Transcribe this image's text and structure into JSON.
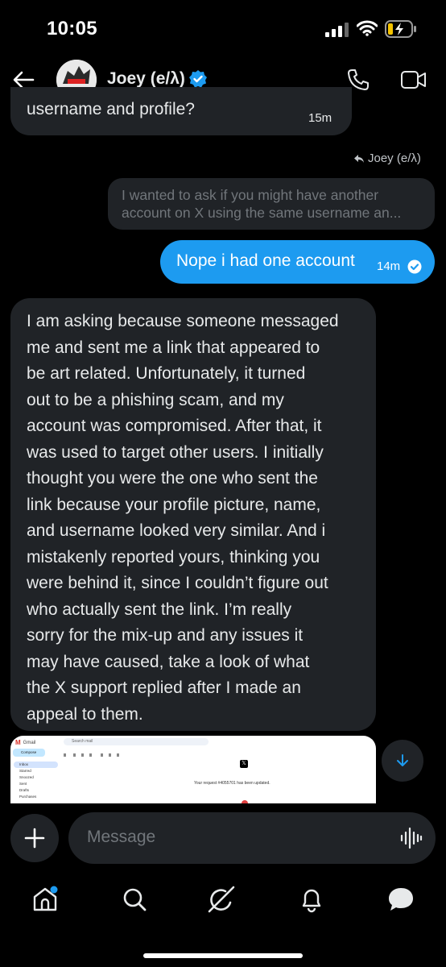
{
  "status_bar": {
    "time": "10:05"
  },
  "header": {
    "name": "Joey (e/λ)"
  },
  "messages": {
    "top": {
      "text": "username and profile?",
      "time": "15m"
    },
    "reply_label": "Joey (e/λ)",
    "quoted": "I wanted to ask if you might have another account on X using the same username an...",
    "outgoing": {
      "text": "Nope i had one account",
      "time": "14m"
    },
    "long_lines": [
      "I am asking because someone messaged",
      "me and sent me a link that appeared to",
      "be art related. Unfortunately, it turned",
      "out to be a phishing scam, and my",
      "account was compromised. After that, it",
      "was used to target other users. I initially",
      "thought you were the one who sent the",
      "link because your profile picture, name,",
      "and username looked very similar. And i",
      "mistakenly reported yours, thinking you",
      "were behind it, since I couldn’t figure out",
      "who actually sent the link. I’m really",
      "sorry for the mix-up and any issues it",
      "may have caused, take a look of what",
      "the X support replied after I made an",
      "appeal to them."
    ]
  },
  "preview": {
    "app": "Gmail",
    "search": "Search mail",
    "compose": "Compose",
    "folders": [
      "Inbox",
      "Starred",
      "Snoozed",
      "Sent",
      "Drafts",
      "Purchases"
    ],
    "notice": "Your request #4055701 has been updated."
  },
  "composer": {
    "placeholder": "Message"
  },
  "icons": {
    "back": "arrow-left-icon",
    "verified": "verified-badge-icon",
    "call": "phone-icon",
    "video": "video-icon",
    "plus": "plus-icon",
    "audio": "audio-wave-icon",
    "scroll": "arrow-down-icon",
    "home": "home-icon",
    "search": "search-icon",
    "grok": "grok-icon",
    "notifications": "bell-icon",
    "messages": "message-bubble-icon"
  },
  "colors": {
    "accent": "#1d9bf0",
    "bubble": "#202327",
    "background": "#000000"
  }
}
